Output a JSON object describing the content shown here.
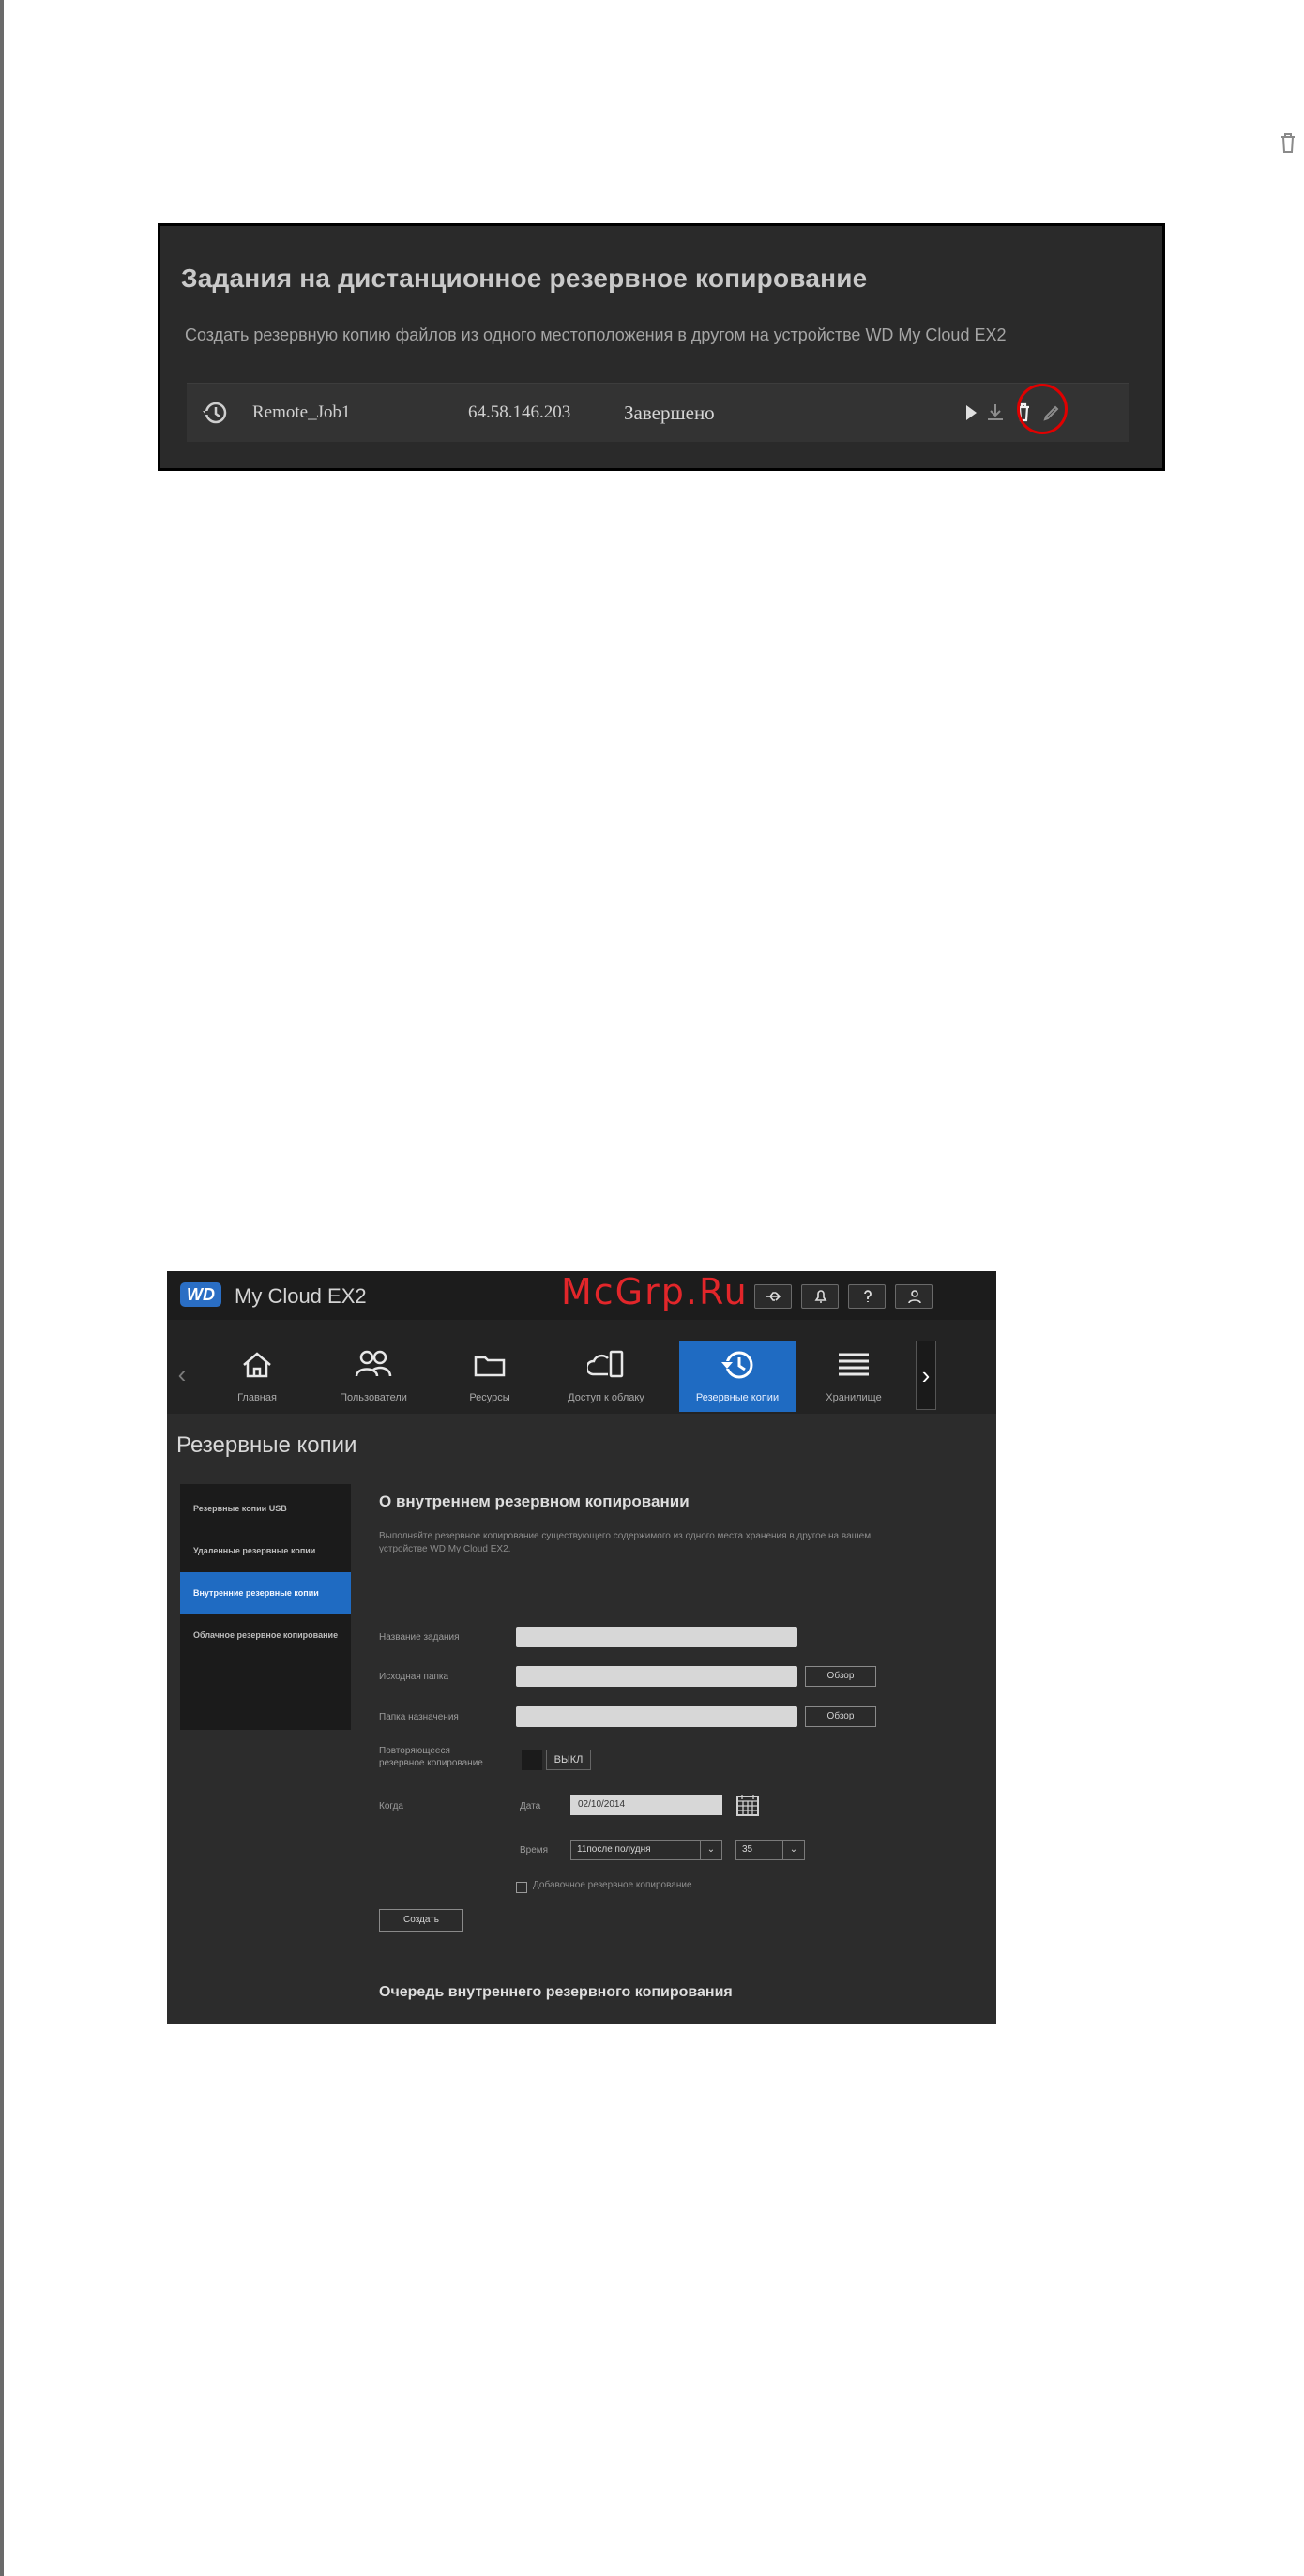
{
  "remote_jobs": {
    "title": "Задания на дистанционное резервное копирование",
    "description": "Создать резервную копию файлов из одного местоположения в другом на устройстве WD My Cloud EX2",
    "job": {
      "name": "Remote_Job1",
      "ip": "64.58.146.203",
      "status": "Завершено"
    }
  },
  "app": {
    "logo_text": "WD",
    "name": "My Cloud EX2",
    "watermark": "McGrp.Ru",
    "toolbar": {
      "icons": [
        "usb-icon",
        "bell-icon",
        "help-icon",
        "user-icon"
      ]
    },
    "nav": [
      {
        "label": "Главная",
        "icon": "home-icon"
      },
      {
        "label": "Пользователи",
        "icon": "users-icon"
      },
      {
        "label": "Ресурсы",
        "icon": "folder-icon"
      },
      {
        "label": "Доступ к облаку",
        "icon": "cloud-device-icon"
      },
      {
        "label": "Резервные копии",
        "icon": "backup-history-icon",
        "active": true
      },
      {
        "label": "Хранилище",
        "icon": "storage-icon"
      }
    ],
    "page_heading": "Резервные копии",
    "sidebar": [
      {
        "label": "Резервные копии USB"
      },
      {
        "label": "Удаленные резервные копии"
      },
      {
        "label": "Внутренние резервные копии",
        "active": true
      },
      {
        "label": "Облачное резервное копирование"
      }
    ],
    "internal_backup": {
      "title": "О внутреннем резервном копировании",
      "description": "Выполняйте резервное копирование существующего содержимого из одного места хранения в другое на вашем устройстве WD My Cloud EX2.",
      "fields": {
        "job_name_label": "Название задания",
        "source_label": "Исходная папка",
        "destination_label": "Папка назначения",
        "browse_label": "Обзор",
        "recurring_label_1": "Повторяющееся",
        "recurring_label_2": "резервное копирование",
        "toggle_value": "ВЫКЛ",
        "when_label": "Когда",
        "date_label": "Дата",
        "date_value": "02/10/2014",
        "time_label": "Время",
        "hour_value": "11после полудня",
        "minute_value": "35",
        "incremental_label": "Добавочное резервное копирование",
        "create_label": "Создать"
      },
      "queue_title": "Очередь внутреннего резервного копирования"
    }
  },
  "colors": {
    "accent_blue": "#1f6bc2",
    "highlight_ring": "#e00000",
    "watermark": "#e2262a"
  }
}
